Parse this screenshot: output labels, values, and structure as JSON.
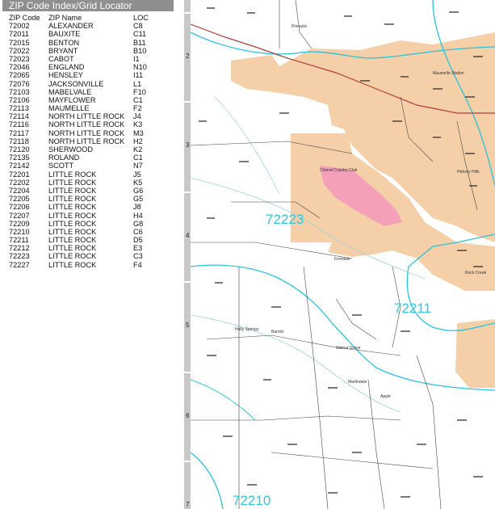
{
  "index": {
    "title": "ZIP Code Index/Grid Locator",
    "headers": {
      "zip": "ZIP Code",
      "name": "ZIP Name",
      "loc": "LOC"
    },
    "rows": [
      [
        "72002",
        "ALEXANDER",
        "C8"
      ],
      [
        "72011",
        "BAUXITE",
        "C11"
      ],
      [
        "72015",
        "BENTON",
        "B11"
      ],
      [
        "72022",
        "BRYANT",
        "B10"
      ],
      [
        "72023",
        "CABOT",
        "I1"
      ],
      [
        "72046",
        "ENGLAND",
        "N10"
      ],
      [
        "72065",
        "HENSLEY",
        "I11"
      ],
      [
        "72076",
        "JACKSONVILLE",
        "L1"
      ],
      [
        "72103",
        "MABELVALE",
        "F10"
      ],
      [
        "72106",
        "MAYFLOWER",
        "C1"
      ],
      [
        "72113",
        "MAUMELLE",
        "F2"
      ],
      [
        "72114",
        "NORTH LITTLE ROCK",
        "J4"
      ],
      [
        "72116",
        "NORTH LITTLE ROCK",
        "K3"
      ],
      [
        "72117",
        "NORTH LITTLE ROCK",
        "M3"
      ],
      [
        "72118",
        "NORTH LITTLE ROCK",
        "H2"
      ],
      [
        "72120",
        "SHERWOOD",
        "K2"
      ],
      [
        "72135",
        "ROLAND",
        "C1"
      ],
      [
        "72142",
        "SCOTT",
        "N7"
      ],
      [
        "72201",
        "LITTLE ROCK",
        "J5"
      ],
      [
        "72202",
        "LITTLE ROCK",
        "K5"
      ],
      [
        "72204",
        "LITTLE ROCK",
        "G6"
      ],
      [
        "72205",
        "LITTLE ROCK",
        "G5"
      ],
      [
        "72206",
        "LITTLE ROCK",
        "J8"
      ],
      [
        "72207",
        "LITTLE ROCK",
        "H4"
      ],
      [
        "72209",
        "LITTLE ROCK",
        "G8"
      ],
      [
        "72210",
        "LITTLE ROCK",
        "C6"
      ],
      [
        "72211",
        "LITTLE ROCK",
        "D5"
      ],
      [
        "72212",
        "LITTLE ROCK",
        "E3"
      ],
      [
        "72223",
        "LITTLE ROCK",
        "C3"
      ],
      [
        "72227",
        "LITTLE ROCK",
        "F4"
      ]
    ]
  },
  "grid_numbers": [
    "2",
    "3",
    "4",
    "5",
    "6",
    "7"
  ],
  "map": {
    "zip_labels": [
      "72223",
      "72211",
      "72210"
    ],
    "place_labels": [
      "Maumelle Station",
      "Hickory Hills",
      "Chenal Country Club",
      "Pinnacle",
      "Ferndale",
      "Holly Springs",
      "Barrett",
      "Walnut Grove",
      "Martindale",
      "Apple",
      "Rock Creek"
    ]
  },
  "colors": {
    "zip_boundary": "#2cc3d9",
    "zip_label": "#33c5dc",
    "urban": "#f5cfa8",
    "park": "#f4a0b8",
    "header_bg": "#8f8f8f",
    "ruler": "#c8c8c8",
    "highway": "#b04040"
  }
}
